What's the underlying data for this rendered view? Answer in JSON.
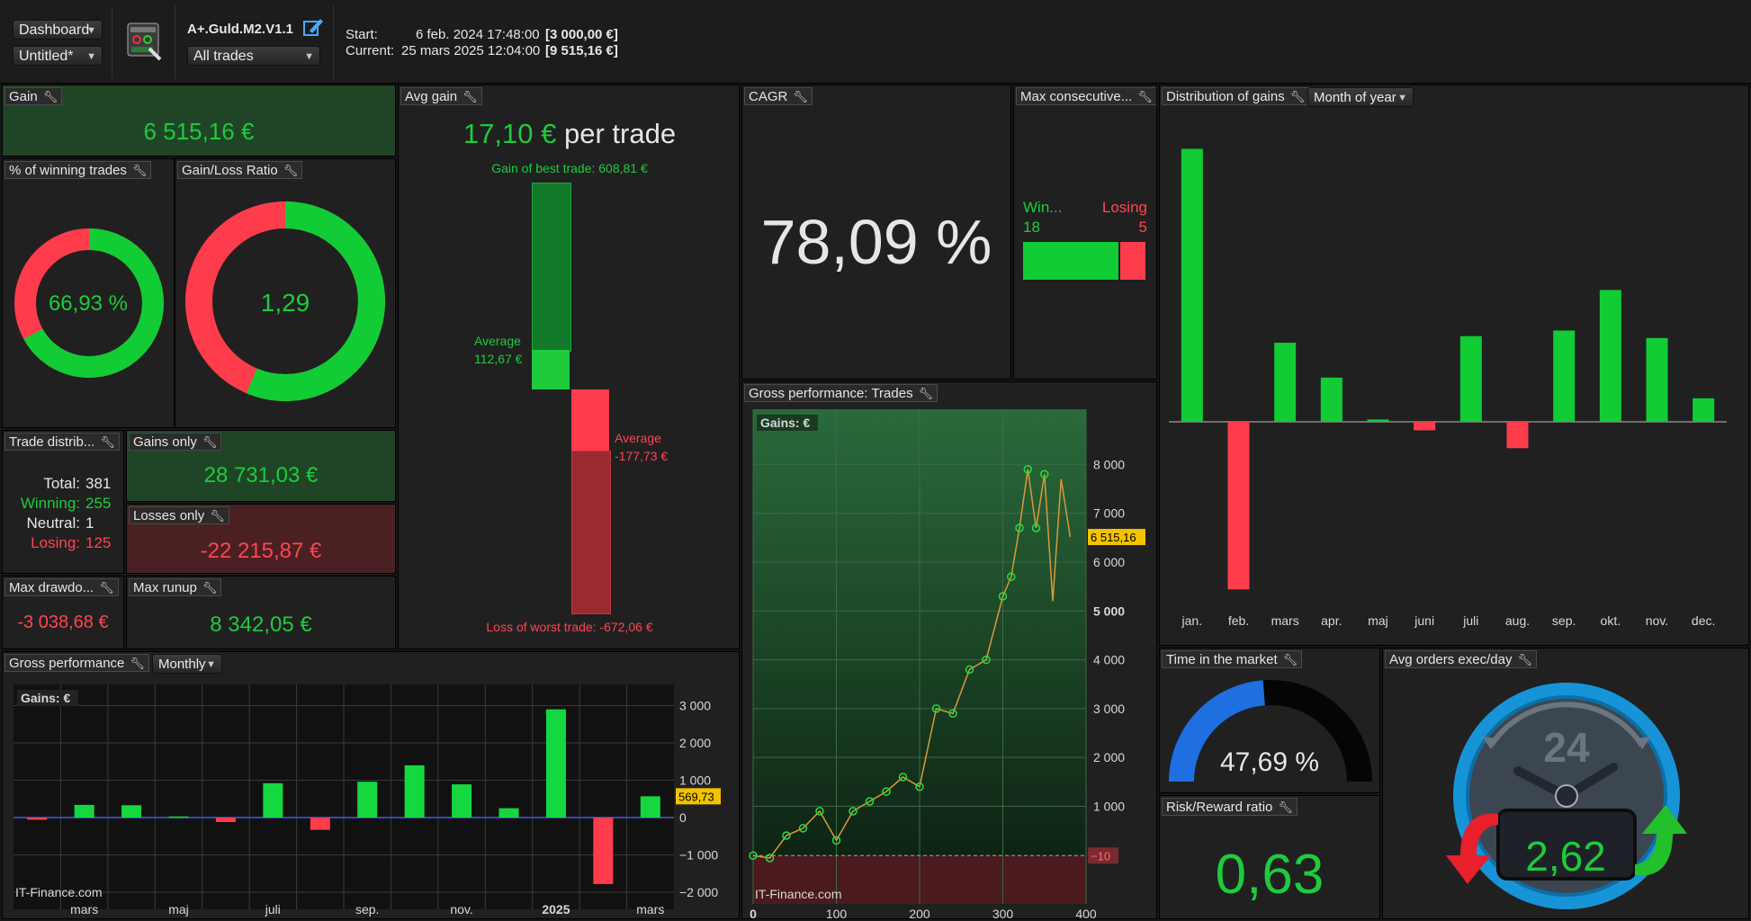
{
  "toolbar": {
    "view_select": "Dashboard",
    "layout_select": "Untitled*",
    "strategy_name": "A+.Guld.M2.V1.1",
    "trades_filter": "All trades",
    "start_label": "Start:",
    "start_date": "6 feb. 2024 17:48:00",
    "start_value": "[3 000,00 €]",
    "current_label": "Current:",
    "current_date": "25 mars 2025 12:04:00",
    "current_value": "[9 515,16 €]"
  },
  "gain": {
    "title": "Gain",
    "value": "6 515,16 €"
  },
  "winning_pct": {
    "title": "% of winning trades",
    "value": "66,93 %",
    "fraction": 0.6693
  },
  "gain_loss_ratio": {
    "title": "Gain/Loss Ratio",
    "value": "1,29",
    "fraction": 0.5633
  },
  "avg_gain": {
    "title": "Avg gain",
    "value": "17,10 €",
    "suffix": "per trade",
    "best_label": "Gain of best trade: 608,81 €",
    "avg_win_label1": "Average",
    "avg_win_label2": "112,67 €",
    "avg_loss_label1": "Average",
    "avg_loss_label2": "-177,73 €",
    "worst_label": "Loss of worst trade: -672,06 €"
  },
  "cagr": {
    "title": "CAGR",
    "value": "78,09 %"
  },
  "max_consecutive": {
    "title": "Max consecutive...",
    "win_label": "Win...",
    "lose_label": "Losing",
    "win_value": "18",
    "lose_value": "5"
  },
  "distribution": {
    "title": "Distribution of gains",
    "period_select": "Month of year",
    "months": [
      "jan.",
      "feb.",
      "mars",
      "apr.",
      "maj",
      "juni",
      "juli",
      "aug.",
      "sep.",
      "okt.",
      "nov.",
      "dec."
    ],
    "values": [
      2900,
      -1780,
      840,
      470,
      25,
      -90,
      910,
      -280,
      970,
      1400,
      890,
      250
    ]
  },
  "trade_distribution": {
    "title": "Trade distrib...",
    "total_label": "Total:",
    "total": "381",
    "winning_label": "Winning:",
    "winning": "255",
    "neutral_label": "Neutral:",
    "neutral": "1",
    "losing_label": "Losing:",
    "losing": "125"
  },
  "gains_only": {
    "title": "Gains only",
    "value": "28 731,03 €"
  },
  "losses_only": {
    "title": "Losses only",
    "value": "-22 215,87 €"
  },
  "max_drawdown": {
    "title": "Max drawdo...",
    "value": "-3 038,68 €"
  },
  "max_runup": {
    "title": "Max runup",
    "value": "8 342,05 €"
  },
  "gross_monthly": {
    "title": "Gross performance",
    "period_select": "Monthly",
    "legend": "Gains: €",
    "watermark": "IT-Finance.com",
    "last_value": "569,73",
    "y_ticks": [
      "3 000",
      "2 000",
      "1 000",
      "0",
      "−1 000",
      "−2 000"
    ],
    "x_labels": [
      "mars",
      "maj",
      "juli",
      "sep.",
      "nov.",
      "2025",
      "mars"
    ]
  },
  "gross_trades": {
    "title": "Gross performance: Trades",
    "legend": "Gains: €",
    "watermark": "IT-Finance.com",
    "last_value": "6 515,16",
    "min_value": "−10",
    "y_ticks": [
      "8 000",
      "7 000",
      "6 000",
      "5 000",
      "4 000",
      "3 000",
      "2 000",
      "1 000"
    ],
    "x_ticks": [
      "0",
      "100",
      "200",
      "300",
      "400"
    ]
  },
  "time_in_market": {
    "title": "Time in the market",
    "value": "47,69 %",
    "fraction": 0.4769
  },
  "risk_reward": {
    "title": "Risk/Reward ratio",
    "value": "0,63"
  },
  "avg_orders": {
    "title": "Avg orders exec/day",
    "value": "2,62",
    "clock_label": "24"
  },
  "chart_data": [
    {
      "type": "bar",
      "title": "Distribution of gains",
      "categories": [
        "jan.",
        "feb.",
        "mars",
        "apr.",
        "maj",
        "juni",
        "juli",
        "aug.",
        "sep.",
        "okt.",
        "nov.",
        "dec."
      ],
      "values": [
        2900,
        -1780,
        840,
        470,
        25,
        -90,
        910,
        -280,
        970,
        1400,
        890,
        250
      ]
    },
    {
      "type": "bar",
      "title": "Gross performance",
      "legend": "Gains: €",
      "x": [
        "2024-02",
        "2024-03",
        "2024-04",
        "2024-05",
        "2024-06",
        "2024-07",
        "2024-08",
        "2024-09",
        "2024-10",
        "2024-11",
        "2024-12",
        "2025-01",
        "2025-02",
        "2025-03"
      ],
      "values": [
        -60,
        340,
        330,
        30,
        -120,
        920,
        -330,
        960,
        1400,
        890,
        250,
        2900,
        -1780,
        570
      ],
      "ylim": [
        -2000,
        3000
      ]
    },
    {
      "type": "line",
      "title": "Gross performance: Trades",
      "legend": "Gains: €",
      "x": [
        0,
        20,
        40,
        60,
        80,
        100,
        120,
        140,
        160,
        180,
        200,
        220,
        240,
        260,
        280,
        300,
        310,
        320,
        330,
        340,
        350,
        360,
        370,
        381
      ],
      "y": [
        -10,
        -60,
        400,
        550,
        900,
        300,
        900,
        1100,
        1300,
        1600,
        1400,
        3000,
        2900,
        3800,
        4000,
        5300,
        5700,
        6700,
        7900,
        6700,
        7800,
        5200,
        7700,
        6515
      ],
      "xlim": [
        0,
        400
      ],
      "ylim": [
        -1000,
        8800
      ]
    }
  ]
}
